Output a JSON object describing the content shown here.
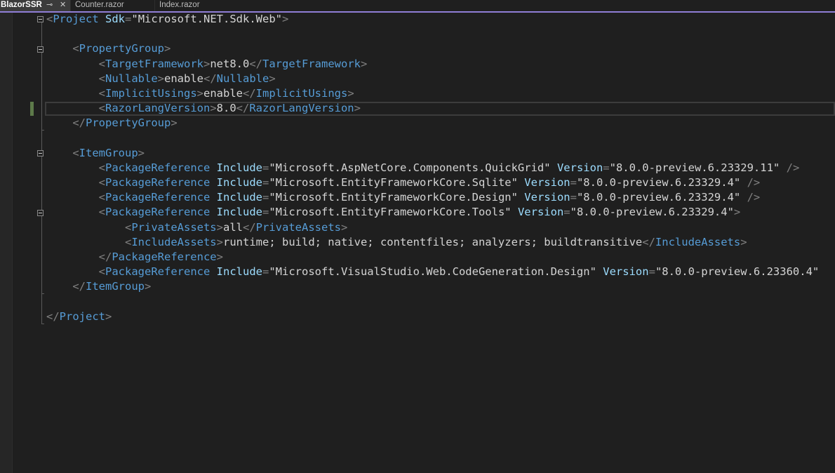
{
  "tabs": {
    "active": "BlazorSSR",
    "pin_icon": "pin-icon",
    "close_icon": "close-icon",
    "t2": "Counter.razor",
    "t3": "Index.razor"
  },
  "colors": {
    "accent": "#8f7ed6",
    "tag": "#569cd6",
    "attr": "#9cdcfe",
    "text": "#d4d4d4",
    "punct": "#808080"
  },
  "code": {
    "l1": {
      "tag": "Project",
      "attr": "Sdk",
      "val": "\"Microsoft.NET.Sdk.Web\""
    },
    "l3": {
      "tag": "PropertyGroup"
    },
    "l4": {
      "tag": "TargetFramework",
      "text": "net8.0"
    },
    "l5": {
      "tag": "Nullable",
      "text": "enable"
    },
    "l6": {
      "tag": "ImplicitUsings",
      "text": "enable"
    },
    "l7": {
      "tag": "RazorLangVersion",
      "text": "8.0"
    },
    "l8": {
      "tag": "PropertyGroup"
    },
    "l10": {
      "tag": "ItemGroup"
    },
    "l11": {
      "tag": "PackageReference",
      "a1": "Include",
      "v1": "\"Microsoft.AspNetCore.Components.QuickGrid\"",
      "a2": "Version",
      "v2": "\"8.0.0-preview.6.23329.11\""
    },
    "l12": {
      "tag": "PackageReference",
      "a1": "Include",
      "v1": "\"Microsoft.EntityFrameworkCore.Sqlite\"",
      "a2": "Version",
      "v2": "\"8.0.0-preview.6.23329.4\""
    },
    "l13": {
      "tag": "PackageReference",
      "a1": "Include",
      "v1": "\"Microsoft.EntityFrameworkCore.Design\"",
      "a2": "Version",
      "v2": "\"8.0.0-preview.6.23329.4\""
    },
    "l14": {
      "tag": "PackageReference",
      "a1": "Include",
      "v1": "\"Microsoft.EntityFrameworkCore.Tools\"",
      "a2": "Version",
      "v2": "\"8.0.0-preview.6.23329.4\""
    },
    "l15": {
      "tag": "PrivateAssets",
      "text": "all"
    },
    "l16": {
      "tag": "IncludeAssets",
      "text": "runtime; build; native; contentfiles; analyzers; buildtransitive"
    },
    "l17": {
      "tag": "PackageReference"
    },
    "l18": {
      "tag": "PackageReference",
      "a1": "Include",
      "v1": "\"Microsoft.VisualStudio.Web.CodeGeneration.Design\"",
      "a2": "Version",
      "v2": "\"8.0.0-preview.6.23360.4\""
    },
    "l19": {
      "tag": "ItemGroup"
    },
    "l21": {
      "tag": "Project"
    }
  }
}
